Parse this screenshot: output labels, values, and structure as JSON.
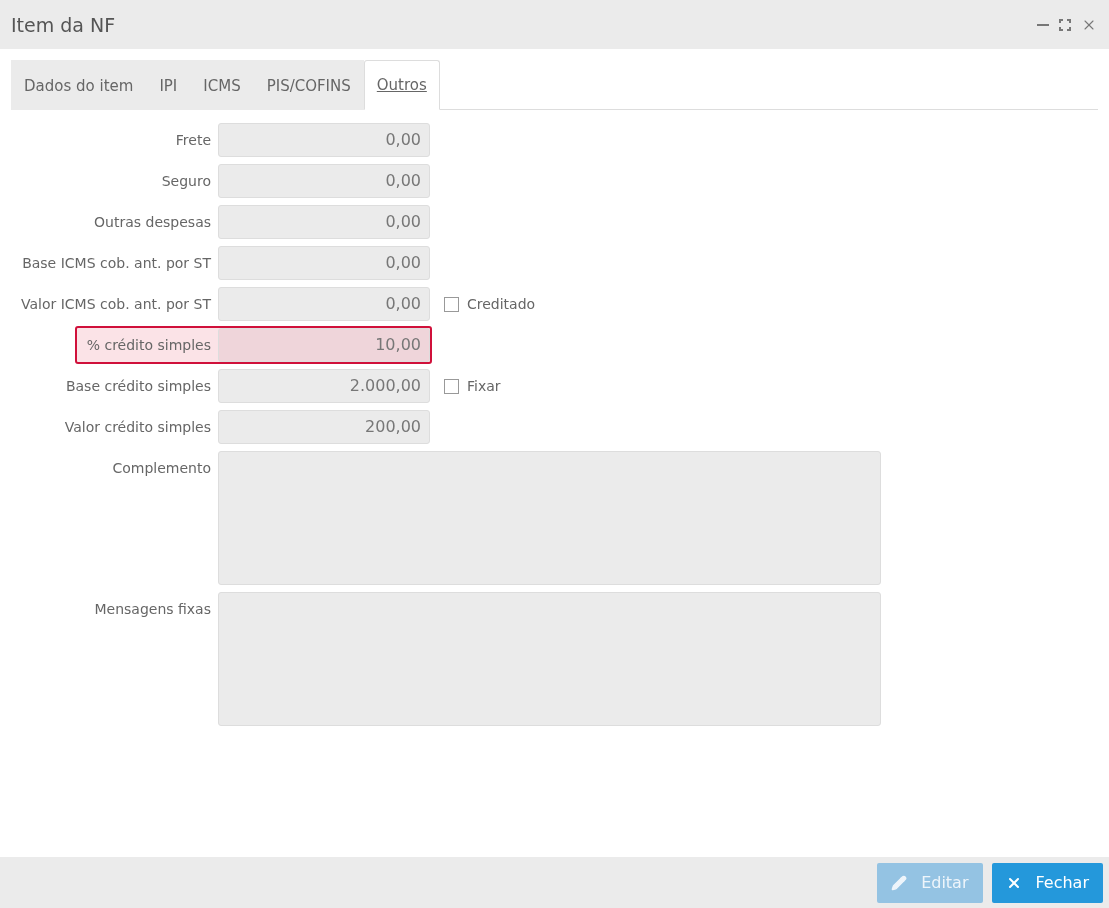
{
  "window": {
    "title": "Item da NF"
  },
  "tabs": [
    {
      "label": "Dados do item",
      "selected": false
    },
    {
      "label": "IPI",
      "selected": false
    },
    {
      "label": "ICMS",
      "selected": false
    },
    {
      "label": "PIS/COFINS",
      "selected": false
    },
    {
      "label": "Outros",
      "selected": true
    }
  ],
  "fields": [
    {
      "kind": "number",
      "label": "Frete",
      "value": "0,00",
      "invalid": false
    },
    {
      "kind": "number",
      "label": "Seguro",
      "value": "0,00",
      "invalid": false
    },
    {
      "kind": "number",
      "label": "Outras despesas",
      "value": "0,00",
      "invalid": false
    },
    {
      "kind": "number",
      "label": "Base ICMS cob. ant. por ST",
      "value": "0,00",
      "invalid": false
    },
    {
      "kind": "number",
      "label": "Valor ICMS cob. ant. por ST",
      "value": "0,00",
      "invalid": false,
      "checkbox": {
        "label": "Creditado",
        "checked": false
      }
    },
    {
      "kind": "number",
      "label": "% crédito simples",
      "value": "10,00",
      "invalid": true
    },
    {
      "kind": "number",
      "label": "Base crédito simples",
      "value": "2.000,00",
      "invalid": false,
      "checkbox": {
        "label": "Fixar",
        "checked": false
      }
    },
    {
      "kind": "number",
      "label": "Valor crédito simples",
      "value": "200,00",
      "invalid": false
    },
    {
      "kind": "textarea",
      "label": "Complemento",
      "invalid": false
    },
    {
      "kind": "textarea",
      "label": "Mensagens fixas",
      "invalid": false
    }
  ],
  "buttons": [
    {
      "kind": "edit",
      "label": "Editar",
      "disabled": true
    },
    {
      "kind": "close",
      "label": "Fechar",
      "disabled": false
    }
  ]
}
